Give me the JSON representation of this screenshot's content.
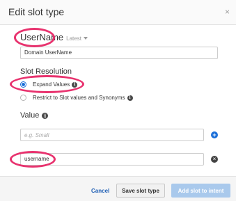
{
  "dialog": {
    "title": "Edit slot type",
    "close_glyph": "×"
  },
  "slot": {
    "name": "UserName",
    "version": "Latest",
    "description_value": "Domain UserName"
  },
  "slot_resolution": {
    "label": "Slot Resolution",
    "options": [
      {
        "label": "Expand Values",
        "selected": true
      },
      {
        "label": "Restrict to Slot values and Synonyms",
        "selected": false
      }
    ]
  },
  "values": {
    "label": "Value",
    "input_placeholder": "e.g. Small",
    "add_glyph": "+",
    "items": [
      "username"
    ],
    "remove_glyph": "×"
  },
  "footer": {
    "cancel_label": "Cancel",
    "save_label": "Save slot type",
    "add_label": "Add slot to intent"
  },
  "colors": {
    "accent": "#1b6fd9",
    "highlight": "#e8326e",
    "disabled_button": "#a9c9ec"
  },
  "icons": {
    "close": "close-icon",
    "caret": "caret-down-icon",
    "info": "info-icon",
    "add": "add-circle-icon",
    "remove": "remove-circle-icon"
  }
}
